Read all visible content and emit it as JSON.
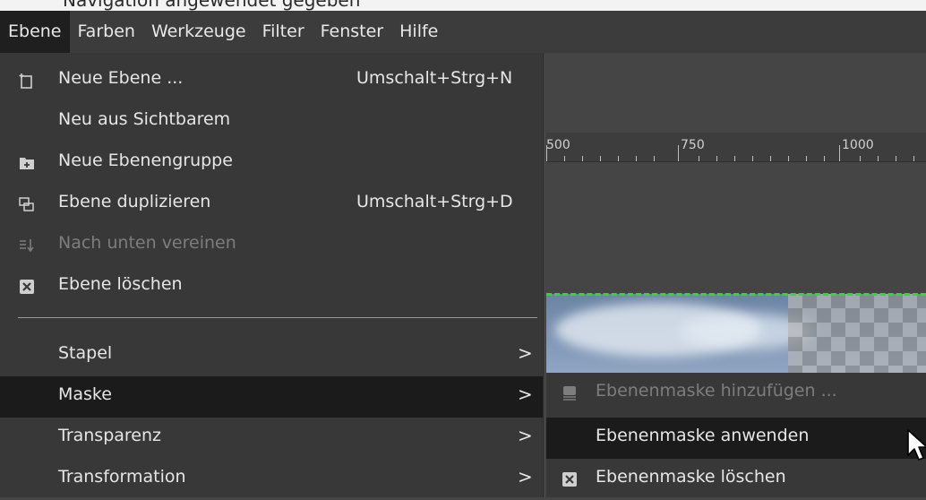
{
  "top_strip_text": "Navigation angewendet gegeben",
  "menubar": {
    "items": [
      "Ebene",
      "Farben",
      "Werkzeuge",
      "Filter",
      "Fenster",
      "Hilfe"
    ]
  },
  "ruler": {
    "labels": [
      "500",
      "750",
      "1000"
    ]
  },
  "menu": {
    "new_layer": {
      "label": "Neue Ebene ...",
      "shortcut": "Umschalt+Strg+N",
      "icon": "new-layer-icon"
    },
    "new_from_visible": {
      "label": "Neu aus Sichtbarem"
    },
    "new_layer_group": {
      "label": "Neue Ebenengruppe",
      "icon": "layer-group-icon"
    },
    "duplicate_layer": {
      "label": "Ebene duplizieren",
      "shortcut": "Umschalt+Strg+D",
      "icon": "duplicate-icon"
    },
    "merge_down": {
      "label": "Nach unten vereinen",
      "icon": "merge-down-icon"
    },
    "delete_layer": {
      "label": "Ebene löschen",
      "icon": "delete-icon"
    },
    "stack": {
      "label": "Stapel"
    },
    "mask": {
      "label": "Maske"
    },
    "transparency": {
      "label": "Transparenz"
    },
    "transform": {
      "label": "Transformation"
    },
    "arrow_glyph": ">"
  },
  "submenu": {
    "add_mask": {
      "label": "Ebenenmaske hinzufügen ...",
      "icon": "add-mask-icon"
    },
    "apply_mask": {
      "label": "Ebenenmaske anwenden"
    },
    "delete_mask": {
      "label": "Ebenenmaske löschen",
      "icon": "delete-icon"
    }
  },
  "colors": {
    "menu_bg": "#383838",
    "highlight_bg": "#1b1b1b",
    "selection_marching_ants": "#33d633"
  }
}
